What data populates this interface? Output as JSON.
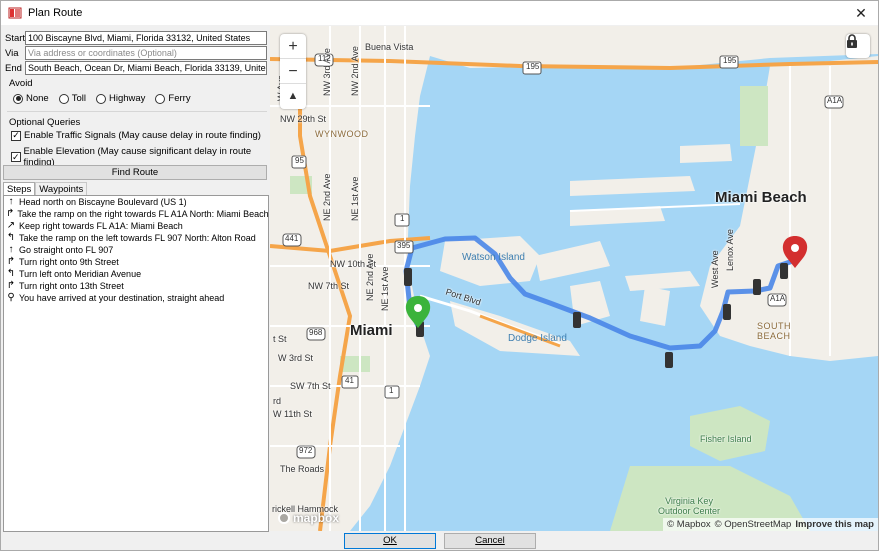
{
  "window": {
    "title": "Plan Route",
    "close_symbol": "✕"
  },
  "form": {
    "start": {
      "label": "Start",
      "value": "100 Biscayne Blvd, Miami, Florida 33132, United States"
    },
    "via": {
      "label": "Via",
      "placeholder": "Via address or coordinates (Optional)"
    },
    "end": {
      "label": "End",
      "value": "South Beach, Ocean Dr, Miami Beach, Florida 33139, United S"
    }
  },
  "avoid": {
    "label": "Avoid",
    "options": [
      "None",
      "Toll",
      "Highway",
      "Ferry"
    ],
    "selected": "None"
  },
  "optional_queries": {
    "label": "Optional Queries",
    "traffic_signals": {
      "label": "Enable Traffic Signals (May cause delay in route finding)",
      "checked": true
    },
    "elevation": {
      "label": "Enable Elevation (May cause significant delay in route finding)",
      "checked": true
    }
  },
  "find_route_label": "Find Route",
  "tabs": [
    "Steps",
    "Waypoints"
  ],
  "active_tab": "Steps",
  "steps": [
    {
      "icon": "arrow-straight-icon",
      "glyph": "↑",
      "text": "Head north on Biscayne Boulevard (US 1)"
    },
    {
      "icon": "ramp-right-icon",
      "glyph": "↱",
      "text": "Take the ramp on the right towards FL A1A North: Miami Beach"
    },
    {
      "icon": "keep-right-icon",
      "glyph": "↗",
      "text": "Keep right towards FL A1A: Miami Beach"
    },
    {
      "icon": "ramp-left-icon",
      "glyph": "↰",
      "text": "Take the ramp on the left towards FL 907 North: Alton Road"
    },
    {
      "icon": "arrow-straight-icon",
      "glyph": "↑",
      "text": "Go straight onto FL 907"
    },
    {
      "icon": "turn-right-icon",
      "glyph": "↱",
      "text": "Turn right onto 9th Street"
    },
    {
      "icon": "turn-left-icon",
      "glyph": "↰",
      "text": "Turn left onto Meridian Avenue"
    },
    {
      "icon": "turn-right-icon",
      "glyph": "↱",
      "text": "Turn right onto 13th Street"
    },
    {
      "icon": "arrive-icon",
      "glyph": "⚲",
      "text": "You have arrived at your destination, straight ahead"
    }
  ],
  "map": {
    "zoom_in": "+",
    "zoom_out": "−",
    "compass": "▲",
    "attribution": {
      "mapbox": "© Mapbox",
      "osm": "© OpenStreetMap",
      "improve": "Improve this map"
    },
    "logo": "mapbox",
    "labels": {
      "buena_vista": "Buena Vista",
      "wynwood": "WYNWOOD",
      "nw29": "NW 29th St",
      "nw10": "NW 10th St",
      "nw7": "NW 7th St",
      "ne1": "NE 1st Ave",
      "ne2": "NE 2nd Ave",
      "miami": "Miami",
      "miami_beach": "Miami Beach",
      "south_beach": "SOUTH\nBEACH",
      "watson": "Watson Island",
      "dodge": "Dodge Island",
      "port_blvd": "Port Blvd",
      "fisher": "Fisher Island",
      "virginia_key": "Virginia Key\nOutdoor Center",
      "the_roads": "The Roads",
      "w3rd": "W 3rd St",
      "sw7": "SW 7th St",
      "w11": "W 11th St",
      "tst": "t St",
      "rd": "rd",
      "hammock": "rickell Hammock",
      "lenox": "Lenox Ave",
      "westave": "West Ave",
      "nw2nd": "NW 2nd Ave",
      "nw3rd": "NW 3rd Ave",
      "nw_ave": "W Ave",
      "ne1_short": "NE 1st Ave",
      "ne2_short": "NE 2nd Ave",
      "shield_112": "112",
      "shield_195": "195",
      "shield_a1a": "A1A",
      "shield_1": "1",
      "shield_395": "395",
      "shield_441": "441",
      "shield_968": "968",
      "shield_41": "41",
      "shield_972": "972",
      "shield_95": "95"
    }
  },
  "footer": {
    "ok": "OK",
    "cancel": "Cancel"
  },
  "colors": {
    "water": "#a5d6f5",
    "land": "#f2efe9",
    "park": "#cde6c2",
    "route": "#4a86e8",
    "highway": "#f5a54a",
    "start_pin": "#3bb33b",
    "end_pin": "#d32f2f"
  }
}
